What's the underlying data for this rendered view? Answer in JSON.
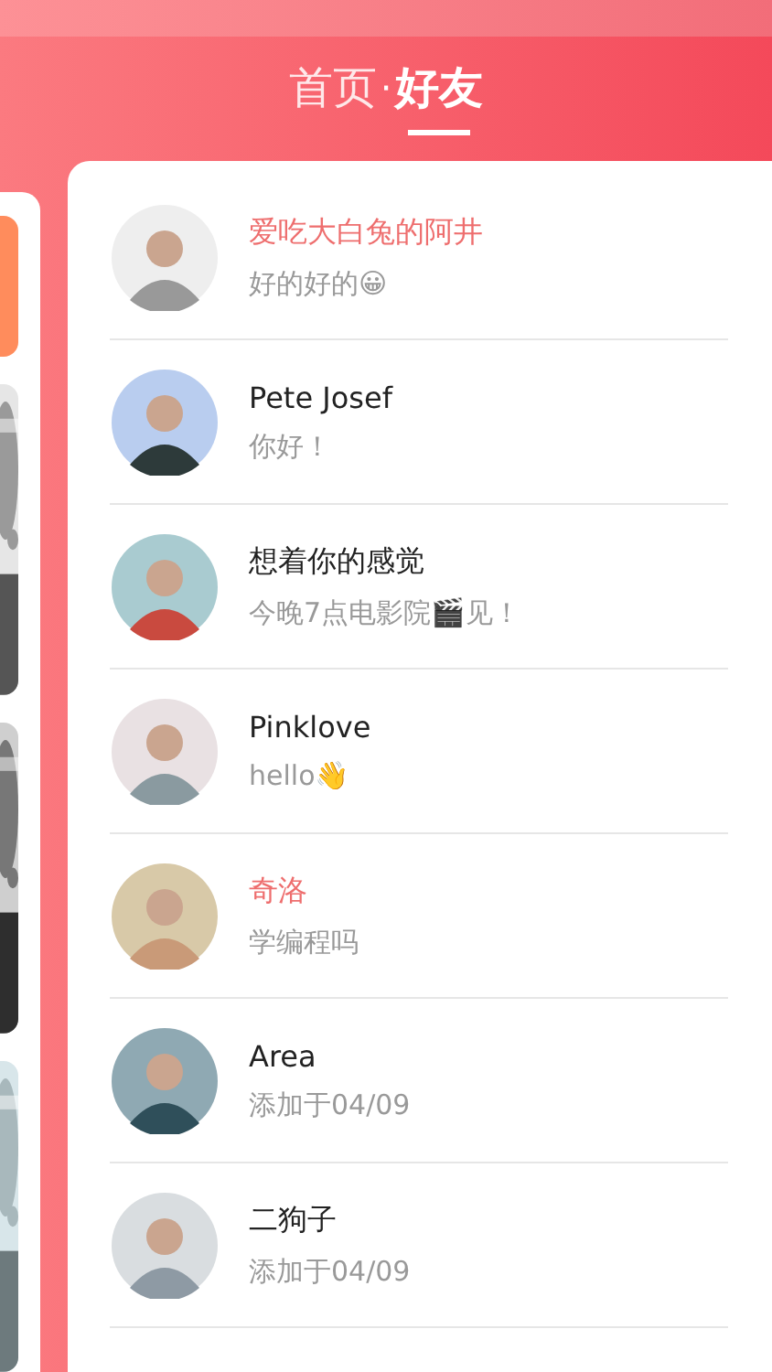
{
  "header": {
    "tabs": [
      {
        "label": "首页",
        "selected": false
      },
      {
        "label": "好友",
        "selected": true
      }
    ],
    "separator": "·"
  },
  "side_cards": [
    {
      "kind": "card"
    },
    {
      "kind": "picture"
    },
    {
      "kind": "picture"
    },
    {
      "kind": "picture"
    }
  ],
  "friends": [
    {
      "name": "爱吃大白兔的阿井",
      "message": "好的好的😀",
      "highlighted": true
    },
    {
      "name": "Pete Josef",
      "message": "你好！",
      "highlighted": false
    },
    {
      "name": "想着你的感觉",
      "message": "今晚7点电影院🎬见！",
      "highlighted": false
    },
    {
      "name": "Pinklove",
      "message": "hello👋",
      "highlighted": false
    },
    {
      "name": "奇洛",
      "message": "学编程吗",
      "highlighted": true
    },
    {
      "name": "Area",
      "message": "添加于04/09",
      "highlighted": false
    },
    {
      "name": "二狗子",
      "message": "添加于04/09",
      "highlighted": false
    }
  ]
}
